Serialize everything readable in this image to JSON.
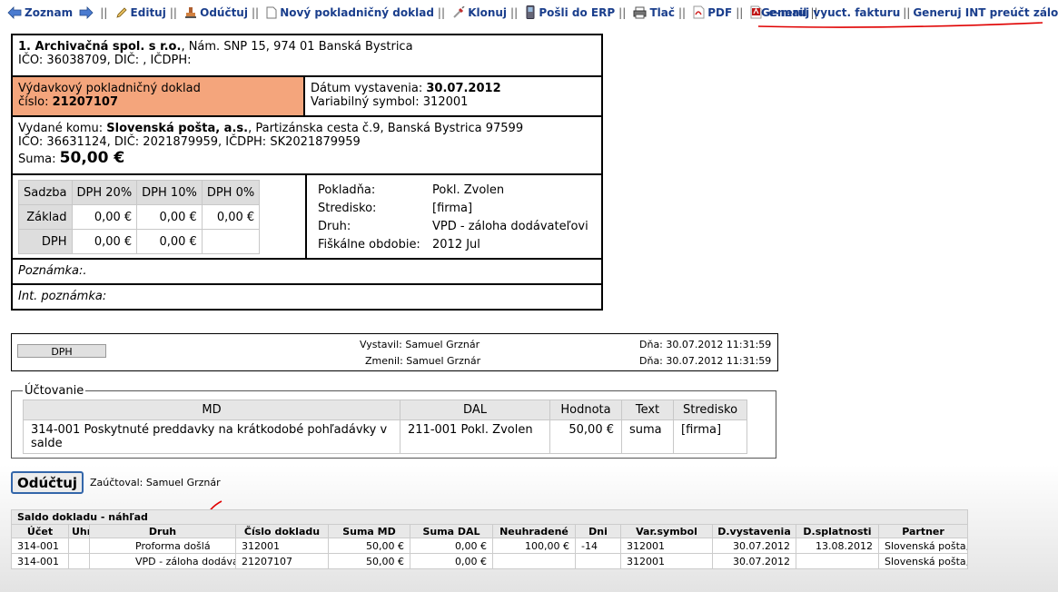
{
  "toolbar": {
    "zoznam": "Zoznam",
    "edituj": "Edituj",
    "oductuj": "Odúčtuj",
    "novy": "Nový pokladničný doklad",
    "klonuj": "Klonuj",
    "posli": "Pošli do ERP",
    "tlac": "Tlač",
    "pdf": "PDF",
    "email": "e-mail",
    "gen_fakturu": "Generuj vyuct. fakturu",
    "gen_int": "Generuj INT preúčt zálohy"
  },
  "company": {
    "name": "1. Archivačná spol. s r.o.",
    "address": ", Nám. SNP 15, 974 01 Banská Bystrica",
    "ids": "IČO: 36038709, DIČ: , IČDPH:"
  },
  "doc": {
    "type": "Výdavkový pokladničný doklad",
    "number_label": "číslo:",
    "number": "21207107",
    "date_label": "Dátum vystavenia:",
    "date": "30.07.2012",
    "vs_label": "Variabilný symbol:",
    "vs": "312001"
  },
  "recipient": {
    "label": "Vydané komu:",
    "name": "Slovenská pošta, a.s.",
    "address": ", Partizánska cesta č.9, Banská Bystrica 97599",
    "ids": "IČO: 36631124, DIČ: 2021879959, IČDPH: SK2021879959",
    "sum_label": "Suma:",
    "sum": "50,00 €"
  },
  "vat": {
    "headers": [
      "Sadzba",
      "DPH 20%",
      "DPH 10%",
      "DPH 0%"
    ],
    "rows": [
      {
        "label": "Základ",
        "values": [
          "0,00 €",
          "0,00 €",
          "0,00 €"
        ]
      },
      {
        "label": "DPH",
        "values": [
          "0,00 €",
          "0,00 €",
          ""
        ]
      }
    ]
  },
  "info": [
    {
      "label": "Pokladňa:",
      "value": "Pokl. Zvolen"
    },
    {
      "label": "Stredisko:",
      "value": "[firma]"
    },
    {
      "label": "Druh:",
      "value": "VPD - záloha dodávateľovi"
    },
    {
      "label": "Fiškálne obdobie:",
      "value": "2012 Jul"
    }
  ],
  "note": "Poznámka:.",
  "int_note": "Int. poznámka:",
  "meta": {
    "dph_button": "DPH",
    "vystavil": "Vystavil: Samuel Grznár",
    "zmenil": "Zmenil: Samuel Grznár",
    "dna1": "Dňa: 30.07.2012 11:31:59",
    "dna2": "Dňa: 30.07.2012 11:31:59"
  },
  "accounting": {
    "legend": "Účtovanie",
    "headers": [
      "MD",
      "DAL",
      "Hodnota",
      "Text",
      "Stredisko"
    ],
    "row": [
      "314-001 Poskytnuté preddavky na krátkodobé pohľadávky v salde",
      "211-001 Pokl. Zvolen",
      "50,00 €",
      "suma",
      "[firma]"
    ]
  },
  "oductuj_button": "Odúčtuj",
  "zauctoval": "Zaúčtoval: Samuel Grznár",
  "saldo": {
    "title": "Saldo dokladu - náhľad",
    "headers": [
      "Účet",
      "Uhr",
      "Druh",
      "Číslo dokladu",
      "Suma MD",
      "Suma DAL",
      "Neuhradené",
      "Dni",
      "Var.symbol",
      "D.vystavenia",
      "D.splatnosti",
      "Partner"
    ],
    "rows": [
      [
        "314-001",
        "",
        "Proforma došlá",
        "312001",
        "50,00 €",
        "0,00 €",
        "100,00 €",
        "-14",
        "312001",
        "30.07.2012",
        "13.08.2012",
        "Slovenská pošta, a.s."
      ],
      [
        "314-001",
        "",
        "VPD - záloha dodávateľovi",
        "21207107",
        "50,00 €",
        "0,00 €",
        "",
        "",
        "312001",
        "30.07.2012",
        "",
        "Slovenská pošta, a.s."
      ]
    ]
  },
  "colors": {
    "link": "#1a3e8c",
    "highlight": "#f4a57c",
    "annotation": "#e00000"
  }
}
